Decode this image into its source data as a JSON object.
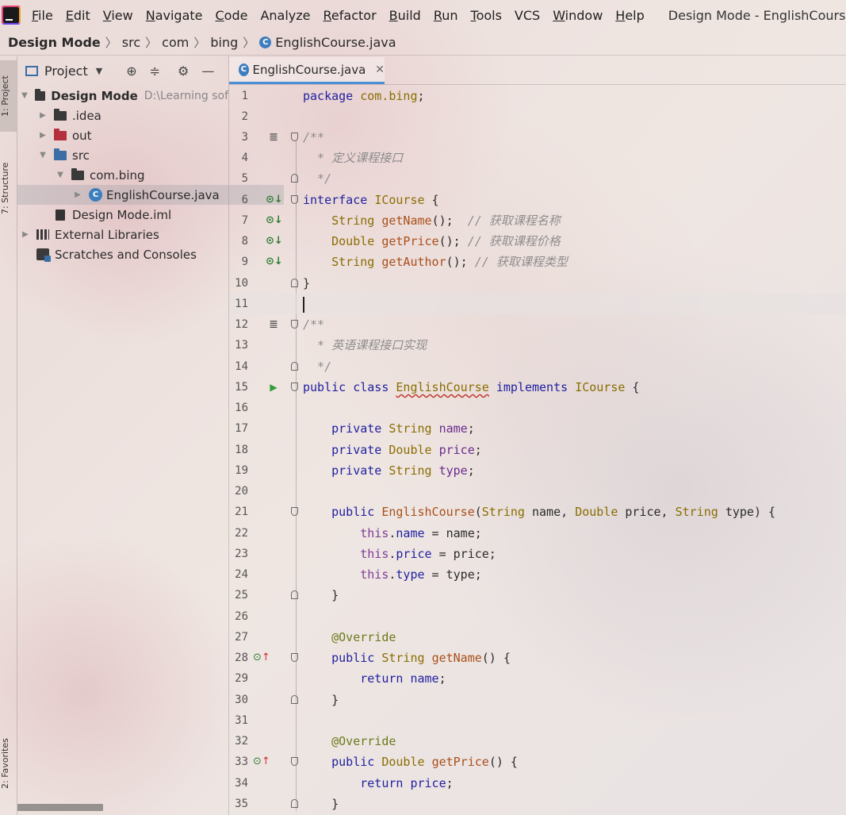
{
  "menu": {
    "items": [
      {
        "u": "F",
        "rest": "ile"
      },
      {
        "u": "E",
        "rest": "dit"
      },
      {
        "u": "V",
        "rest": "iew"
      },
      {
        "u": "N",
        "rest": "avigate"
      },
      {
        "u": "C",
        "rest": "ode"
      },
      {
        "u": "",
        "rest": "Analyze"
      },
      {
        "u": "R",
        "rest": "efactor"
      },
      {
        "u": "B",
        "rest": "uild"
      },
      {
        "u": "R",
        "rest": "un"
      },
      {
        "u": "T",
        "rest": "ools"
      },
      {
        "u": "",
        "rest": "VCS"
      },
      {
        "u": "W",
        "rest": "indow"
      },
      {
        "u": "H",
        "rest": "elp"
      }
    ],
    "window_title": "Design Mode - EnglishCourse.java - I"
  },
  "breadcrumb": {
    "project": "Design Mode",
    "parts": [
      "src",
      "com",
      "bing"
    ],
    "file": "EnglishCourse.java"
  },
  "side_tabs": {
    "project": "1: Project",
    "structure": "7: Structure",
    "favorites": "2: Favorites"
  },
  "project_panel": {
    "title": "Project",
    "root": {
      "name": "Design Mode",
      "path": "D:\\Learning sof"
    },
    "items": {
      "idea": ".idea",
      "out": "out",
      "src": "src",
      "pkg": "com.bing",
      "file": "EnglishCourse.java",
      "iml": "Design Mode.iml",
      "libs": "External Libraries",
      "scratches": "Scratches and Consoles"
    }
  },
  "editor": {
    "tab_label": "EnglishCourse.java"
  }
}
